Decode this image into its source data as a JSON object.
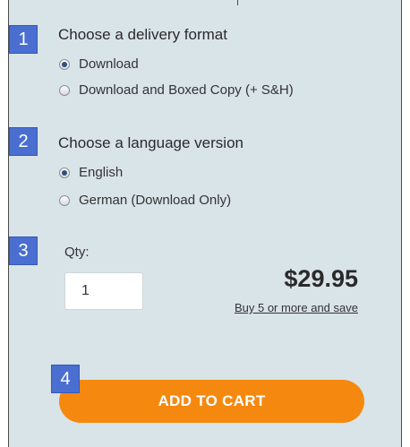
{
  "steps": [
    {
      "number": "1",
      "title": "Choose a delivery format"
    },
    {
      "number": "2",
      "title": "Choose a language version"
    },
    {
      "number": "3"
    },
    {
      "number": "4"
    }
  ],
  "delivery": {
    "options": [
      {
        "label": "Download",
        "selected": true
      },
      {
        "label": "Download and Boxed Copy (+ S&H)",
        "selected": false
      }
    ]
  },
  "language": {
    "options": [
      {
        "label": "English",
        "selected": true
      },
      {
        "label": "German (Download Only)",
        "selected": false
      }
    ]
  },
  "quantity": {
    "label": "Qty:",
    "value": "1"
  },
  "price": "$29.95",
  "save_link": "Buy 5 or more and save",
  "add_to_cart": "ADD TO CART",
  "colors": {
    "badge": "#4a6fd0",
    "button": "#f5890f",
    "panel": "#d9e4e9"
  }
}
